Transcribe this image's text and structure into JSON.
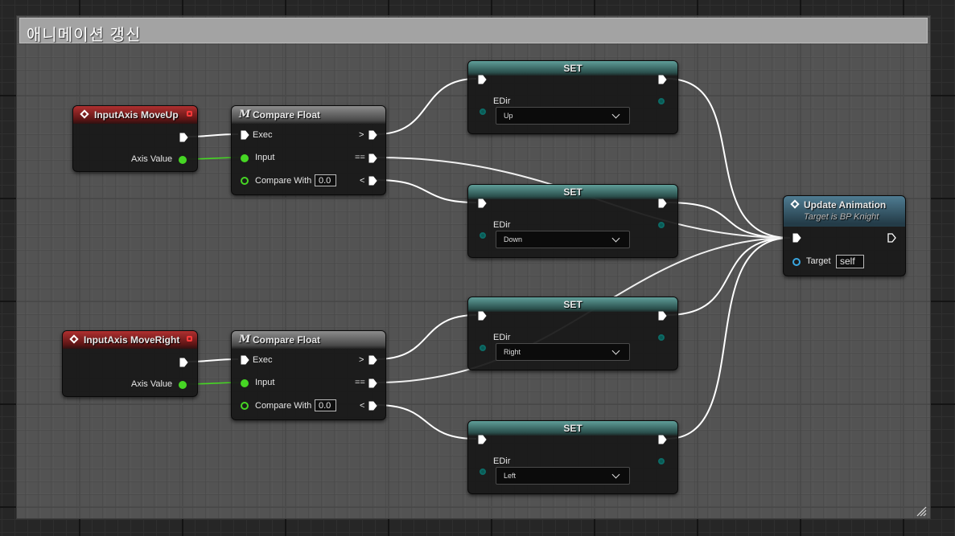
{
  "comment": {
    "title": "애니메이션 갱신"
  },
  "input_up": {
    "title": "InputAxis MoveUp",
    "axis_label": "Axis Value"
  },
  "input_right": {
    "title": "InputAxis MoveRight",
    "axis_label": "Axis Value"
  },
  "compare_1": {
    "title": "Compare Float",
    "m": "M",
    "exec": "Exec",
    "input": "Input",
    "compare_with": "Compare With",
    "compare_value": "0.0",
    "gt": ">",
    "eq": "==",
    "lt": "<"
  },
  "compare_2": {
    "title": "Compare Float",
    "m": "M",
    "exec": "Exec",
    "input": "Input",
    "compare_with": "Compare With",
    "compare_value": "0.0",
    "gt": ">",
    "eq": "==",
    "lt": "<"
  },
  "set_up": {
    "title": "SET",
    "var": "EDir",
    "value": "Up"
  },
  "set_down": {
    "title": "SET",
    "var": "EDir",
    "value": "Down"
  },
  "set_right": {
    "title": "SET",
    "var": "EDir",
    "value": "Right"
  },
  "set_left": {
    "title": "SET",
    "var": "EDir",
    "value": "Left"
  },
  "update": {
    "title": "Update Animation",
    "subtitle": "Target is BP Knight",
    "target_label": "Target",
    "target_value": "self"
  },
  "colors": {
    "exec_wire": "#ffffff",
    "float_wire": "#46d624",
    "event_header": "#b03030",
    "set_header": "#5f9e99",
    "function_header": "#4f7c92"
  }
}
